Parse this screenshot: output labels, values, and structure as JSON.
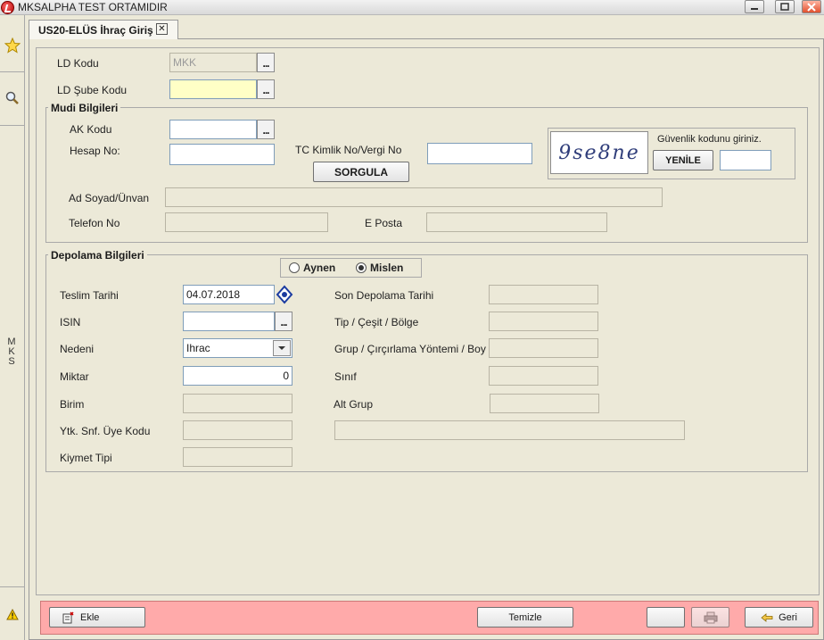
{
  "window": {
    "title": "MKSALPHA TEST ORTAMIDIR"
  },
  "sidebar": {
    "vertical_text": "M\nK\nS"
  },
  "tab": {
    "label": "US20-ELÜS İhraç Giriş",
    "close": "☒"
  },
  "header": {
    "ld_kodu_label": "LD Kodu",
    "ld_kodu_value": "MKK",
    "ld_sube_label": "LD Şube Kodu",
    "ld_sube_value": ""
  },
  "mudi": {
    "title": "Mudi Bilgileri",
    "ak_kodu_label": "AK Kodu",
    "hesap_no_label": "Hesap No:",
    "tc_label": "TC Kimlik No/Vergi No",
    "sorgula": "SORGULA",
    "captcha_text": "9se8ne",
    "guvenlik_label": "Güvenlik kodunu giriniz.",
    "yenile": "YENİLE",
    "ad_soyad_label": "Ad Soyad/Ünvan",
    "telefon_label": "Telefon No",
    "eposta_label": "E Posta"
  },
  "depolama": {
    "title": "Depolama Bilgileri",
    "radio_aynen": "Aynen",
    "radio_mislen": "Mislen",
    "selected": "Mislen",
    "teslim_label": "Teslim Tarihi",
    "teslim_value": "04.07.2018",
    "isin_label": "ISIN",
    "nedeni_label": "Nedeni",
    "nedeni_value": "Ihrac",
    "miktar_label": "Miktar",
    "miktar_value": "0",
    "birim_label": "Birim",
    "ytk_label": "Ytk. Snf. Üye Kodu",
    "kiymet_label": "Kiymet Tipi",
    "son_depolama_label": "Son Depolama Tarihi",
    "tip_label": "Tip / Çeşit / Bölge",
    "grup_label": "Grup / Çırçırlama Yöntemi / Boy",
    "sinif_label": "Sınıf",
    "alt_grup_label": "Alt Grup"
  },
  "footer": {
    "ekle": "Ekle",
    "temizle": "Temizle",
    "geri": "Geri"
  }
}
